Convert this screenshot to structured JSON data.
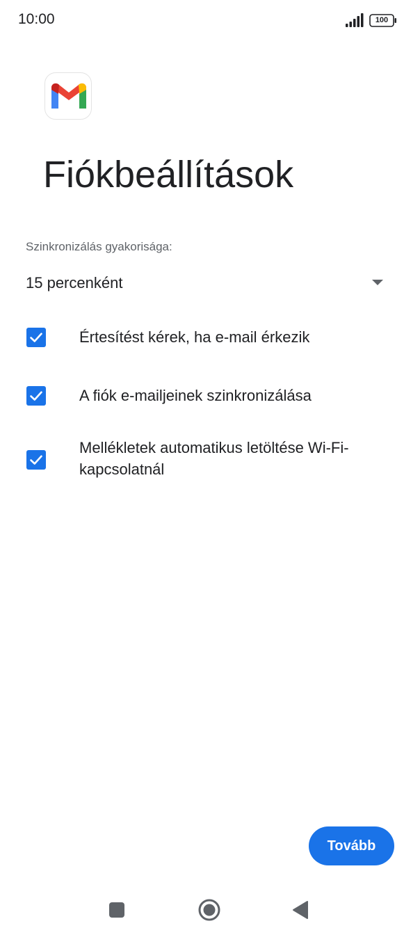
{
  "status_bar": {
    "time": "10:00",
    "battery": "100",
    "icons": [
      "signal-icon",
      "battery-icon"
    ]
  },
  "app": {
    "logo_icon": "gmail-logo-icon"
  },
  "page": {
    "title": "Fiókbeállítások"
  },
  "sync": {
    "label": "Szinkronizálás gyakorisága:",
    "selected": "15 percenként",
    "icon": "dropdown-arrow-icon"
  },
  "options": [
    {
      "label": "Értesítést kérek, ha e-mail érkezik",
      "checked": true
    },
    {
      "label": "A fiók e-mailjeinek szinkronizálása",
      "checked": true
    },
    {
      "label": "Mellékletek automatikus letöltése Wi-Fi-kapcsolatnál",
      "checked": true
    }
  ],
  "actions": {
    "next_label": "Tovább"
  },
  "navigation": {
    "buttons": [
      "recents-square-icon",
      "home-circle-icon",
      "back-triangle-icon"
    ]
  },
  "colors": {
    "accent": "#1a73e8",
    "text": "#202124",
    "secondary_text": "#5f6368",
    "background": "#ffffff"
  }
}
